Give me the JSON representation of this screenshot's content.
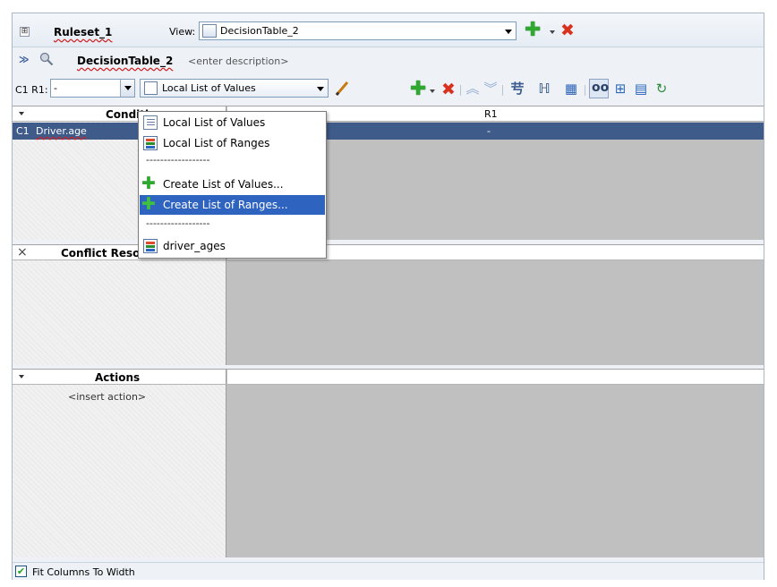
{
  "ruleset": {
    "expand_glyph": "⊞",
    "name": "Ruleset_1",
    "view_label": "View:",
    "view_value": "DecisionTable_2"
  },
  "decision_table": {
    "collapse_glyph": "≫",
    "name": "DecisionTable_2",
    "description_placeholder": "<enter description>"
  },
  "toolbar": {
    "cell_label": "C1 R1:",
    "cell_value": "-",
    "list_type_value": "Local List of Values",
    "icons": [
      "pencil-icon",
      "add-icon",
      "delete-icon",
      "move-up-icon",
      "move-down-icon",
      "split-icon",
      "merge-icon",
      "find-gaps-icon",
      "show-conflicts-icon",
      "compact-table-icon",
      "print-icon",
      "refresh-icon"
    ]
  },
  "conditions": {
    "header": "Conditions",
    "column_header": "R1",
    "rows": [
      {
        "id": "C1",
        "name": "Driver.age",
        "r1": "-"
      }
    ]
  },
  "conflict": {
    "close_glyph": "×",
    "header": "Conflict Resolution"
  },
  "actions": {
    "header": "Actions",
    "placeholder": "<insert action>"
  },
  "menu": {
    "items": [
      {
        "type": "item",
        "label": "Local List of Values",
        "icon": "list-of-values-icon"
      },
      {
        "type": "item",
        "label": "Local List of Ranges",
        "icon": "list-of-ranges-icon"
      },
      {
        "type": "separator",
        "label": "------------------"
      },
      {
        "type": "item",
        "label": "Create List of Values...",
        "icon": "green-plus-icon"
      },
      {
        "type": "item",
        "label": "Create List of Ranges...",
        "icon": "green-plus-icon",
        "highlighted": true
      },
      {
        "type": "separator",
        "label": "------------------"
      },
      {
        "type": "item",
        "label": "driver_ages",
        "icon": "list-of-ranges-icon"
      }
    ]
  },
  "footer": {
    "fit_columns_label": "Fit Columns To Width",
    "fit_columns_checked": true
  },
  "colors": {
    "selection": "#3f5b8a",
    "menu_highlight": "#2e63c0",
    "grid_bg": "#c0c0c0"
  }
}
